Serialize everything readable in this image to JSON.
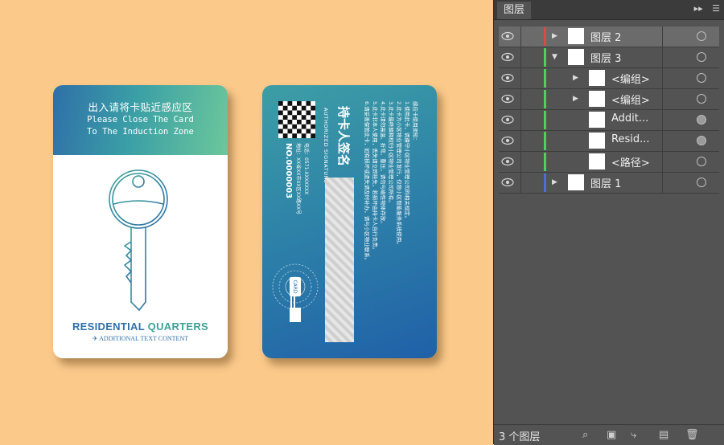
{
  "front_card": {
    "title_cn": "出入请将卡贴近感应区",
    "line1": "Please Close The Card",
    "line2": "To The Induction Zone",
    "brand_a": "RESIDENTIAL",
    "brand_b": "QUARTERS",
    "additional": "ADDITIONAL TEXT CONTENT"
  },
  "back_card": {
    "signature": "持卡人签名",
    "signature_en": "AUTHORIZED SIGNATURE",
    "number": "NO.0000003",
    "tel": "电话：0571-XXXXXXX",
    "addr": "地址：XX省XX市XX区XX路XX号",
    "rules": [
      "感应卡使用须知：",
      "1.使用此卡，请遵守小区物业管理公司的相关规定。",
      "2.此卡为小区物业管理公司发行，仅限小区智能服务系统使用。",
      "3.此卡最终解释权归小区物业管理公司所有。",
      "4.此卡请勿高温、折弯、重压，请勿与磁性物体存放。",
      "5.此卡非本人使用，丢失请立即挂失，若损坏由持卡人自行负责。",
      "6.请妥善保管此卡，如有损坏或遗失请及时补办，请与小区物业联系。"
    ],
    "card_label": "CARD"
  },
  "layers_panel": {
    "tab_label": "图层",
    "layers": [
      {
        "name": "图层 2",
        "indent": 0,
        "expanded": false,
        "color": "#d94a4a",
        "selected": true,
        "target_filled": false
      },
      {
        "name": "图层 3",
        "indent": 0,
        "expanded": true,
        "color": "#4fd05a",
        "selected": false,
        "target_filled": false
      },
      {
        "name": "<编组>",
        "indent": 1,
        "expanded": false,
        "color": "#4fd05a",
        "selected": false,
        "target_filled": false
      },
      {
        "name": "<编组>",
        "indent": 1,
        "expanded": false,
        "color": "#4fd05a",
        "selected": false,
        "target_filled": false
      },
      {
        "name": "Addit...",
        "indent": 2,
        "expanded": null,
        "color": "#4fd05a",
        "selected": false,
        "target_filled": true
      },
      {
        "name": "Resid...",
        "indent": 2,
        "expanded": null,
        "color": "#4fd05a",
        "selected": false,
        "target_filled": true
      },
      {
        "name": "<路径>",
        "indent": 2,
        "expanded": null,
        "color": "#4fd05a",
        "selected": false,
        "target_filled": false
      },
      {
        "name": "图层 1",
        "indent": 0,
        "expanded": false,
        "color": "#4a6fd9",
        "selected": false,
        "target_filled": false
      }
    ],
    "footer_count": "3 个图层"
  },
  "colors": {
    "background": "#fbc98a",
    "panel": "#535353",
    "brand_blue": "#2f6fa8",
    "brand_teal": "#3aa198"
  }
}
